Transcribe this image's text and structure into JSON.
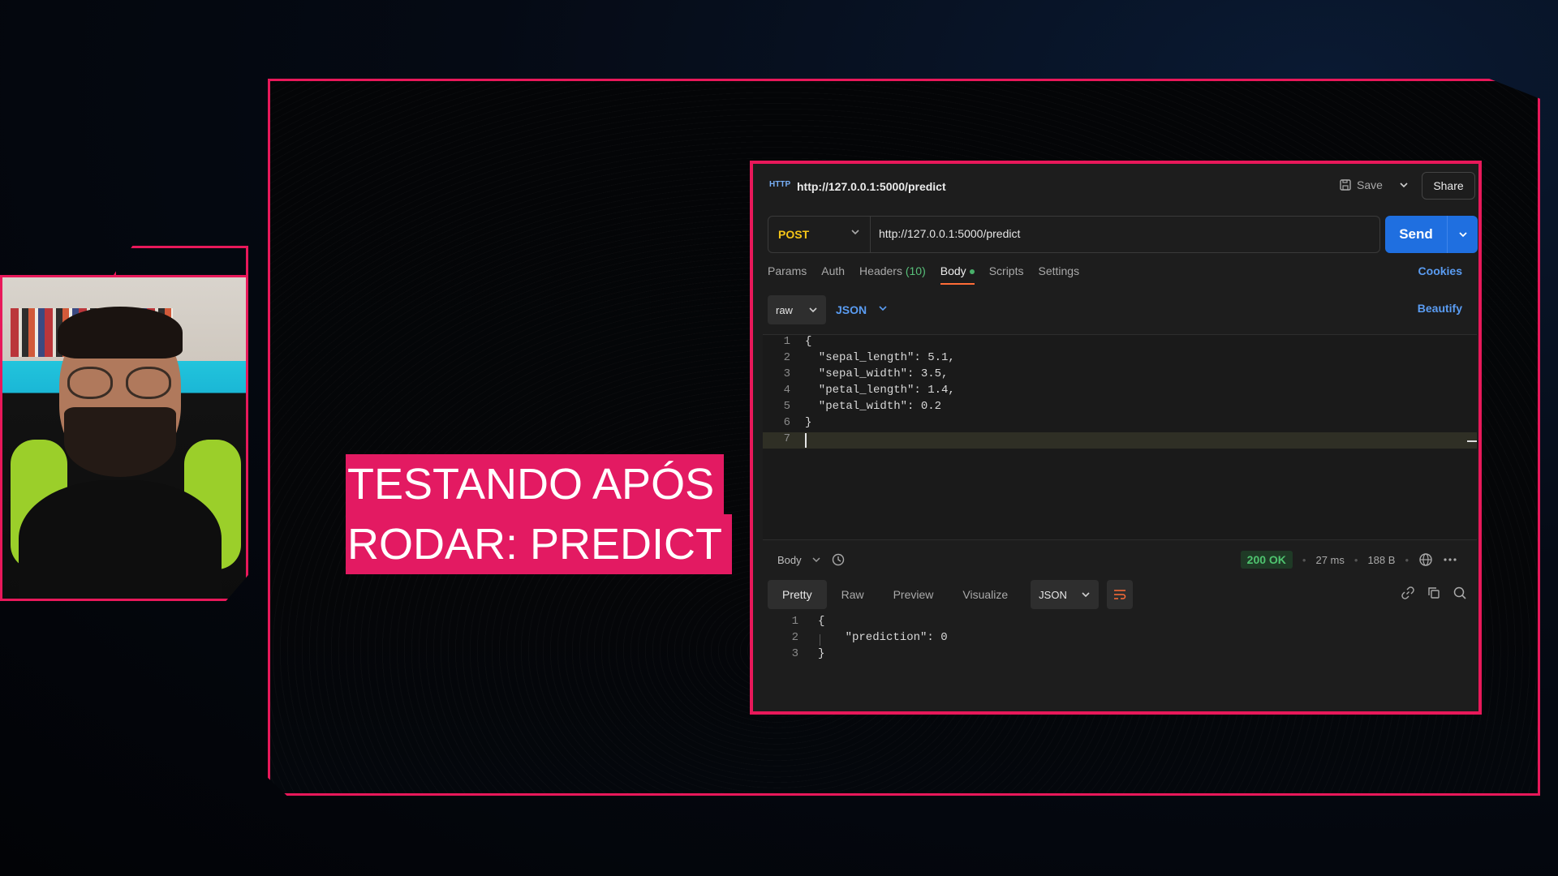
{
  "overlay": {
    "title_lines": [
      "TESTANDO APÓS",
      "RODAR: PREDICT"
    ]
  },
  "postman": {
    "header": {
      "tab_title": "http://127.0.0.1:5000/predict",
      "http_badge": "HTTP",
      "save_label": "Save",
      "share_label": "Share"
    },
    "request": {
      "method": "POST",
      "url": "http://127.0.0.1:5000/predict",
      "send_label": "Send"
    },
    "tabs": {
      "params": "Params",
      "auth": "Auth",
      "headers": "Headers",
      "headers_count": "(10)",
      "body": "Body",
      "scripts": "Scripts",
      "settings": "Settings",
      "cookies": "Cookies"
    },
    "body_bar": {
      "mode": "raw",
      "format": "JSON",
      "beautify": "Beautify"
    },
    "editor": {
      "lines": [
        {
          "n": "1",
          "text": "{"
        },
        {
          "n": "2",
          "text": "  \"sepal_length\": 5.1,"
        },
        {
          "n": "3",
          "text": "  \"sepal_width\": 3.5,"
        },
        {
          "n": "4",
          "text": "  \"petal_length\": 1.4,"
        },
        {
          "n": "5",
          "text": "  \"petal_width\": 0.2"
        },
        {
          "n": "6",
          "text": "}"
        },
        {
          "n": "7",
          "text": ""
        }
      ]
    },
    "response": {
      "section_label": "Body",
      "status": "200 OK",
      "time": "27 ms",
      "size": "188 B",
      "tabs": {
        "pretty": "Pretty",
        "raw": "Raw",
        "preview": "Preview",
        "visualize": "Visualize",
        "format": "JSON"
      },
      "lines": [
        {
          "n": "1",
          "text": "{"
        },
        {
          "n": "2",
          "text": "    \"prediction\": 0"
        },
        {
          "n": "3",
          "text": "}"
        }
      ]
    },
    "colors": {
      "accent_frame": "#e8185a",
      "send_button": "#1f6fe0",
      "method": "#f5c518",
      "status_ok": "#4fc36f",
      "link_blue": "#5a9cf2"
    }
  }
}
